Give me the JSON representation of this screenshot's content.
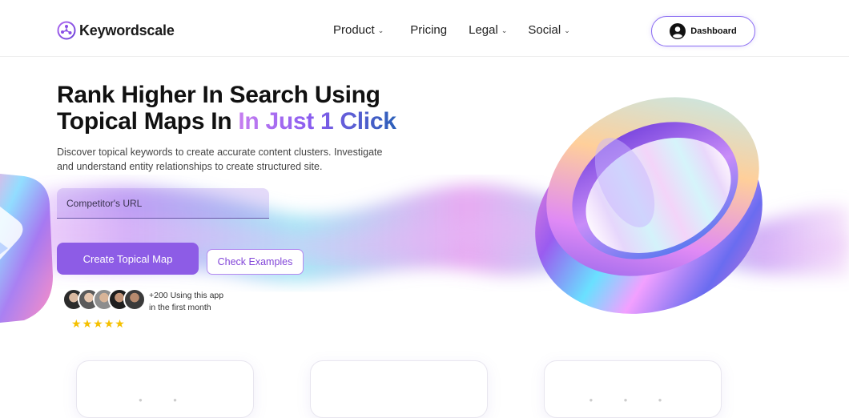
{
  "nav": {
    "brand": "Keywordscale",
    "items": [
      {
        "label": "Product",
        "dropdown": true
      },
      {
        "label": "Pricing",
        "dropdown": false
      },
      {
        "label": "Legal",
        "dropdown": true
      },
      {
        "label": "Social",
        "dropdown": true
      }
    ],
    "dashboard_label": "Dashboard"
  },
  "hero": {
    "title_line1": "Rank Higher In Search Using",
    "title_line2_plain": "Topical Maps In ",
    "title_line2_highlight": "In Just 1 Click",
    "subtitle": "Discover topical keywords to create accurate content clusters. Investigate and understand entity relationships to create structured site.",
    "url_placeholder": "Competitor's URL",
    "create_button": "Create Topical Map",
    "examples_button": "Check Examples",
    "social_proof_line1": "+200 Using this app",
    "social_proof_line2": "in the first month",
    "rating_stars": 5
  },
  "colors": {
    "accent": "#8d5ce6",
    "accent_border": "#b48af0",
    "star": "#f5c000"
  },
  "icons": {
    "logo": "network-logo-icon",
    "dashboard": "user-circle-icon",
    "chevron": "chevron-down-icon"
  }
}
